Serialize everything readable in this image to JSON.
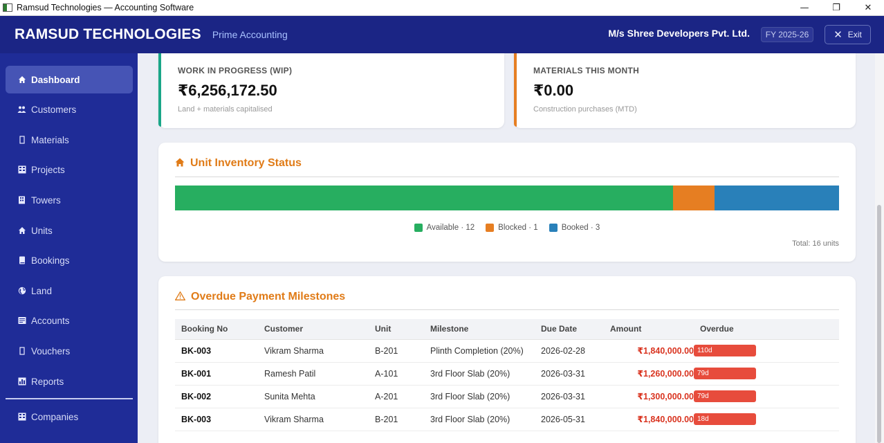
{
  "window": {
    "title": "Ramsud Technologies — Accounting Software"
  },
  "header": {
    "brand": "RAMSUD TECHNOLOGIES",
    "subtitle": "Prime Accounting",
    "company": "M/s Shree Developers Pvt. Ltd.",
    "fy": "FY 2025-26",
    "exit_label": "Exit"
  },
  "sidebar": {
    "items": [
      {
        "label": "Dashboard",
        "icon": "home-icon",
        "active": true
      },
      {
        "label": "Customers",
        "icon": "users-icon"
      },
      {
        "label": "Materials",
        "icon": "box-icon"
      },
      {
        "label": "Projects",
        "icon": "grid-icon"
      },
      {
        "label": "Towers",
        "icon": "building-icon"
      },
      {
        "label": "Units",
        "icon": "home-icon"
      },
      {
        "label": "Bookings",
        "icon": "book-icon"
      },
      {
        "label": "Land",
        "icon": "globe-icon"
      },
      {
        "label": "Accounts",
        "icon": "ledger-icon"
      },
      {
        "label": "Vouchers",
        "icon": "voucher-icon"
      },
      {
        "label": "Reports",
        "icon": "chart-icon"
      },
      {
        "label": "Companies",
        "icon": "grid-icon"
      }
    ]
  },
  "cards": {
    "wip": {
      "label": "WORK IN PROGRESS (WIP)",
      "value": "₹6,256,172.50",
      "sub": "Land + materials capitalised",
      "color": "#1aa688"
    },
    "materials": {
      "label": "MATERIALS THIS MONTH",
      "value": "₹0.00",
      "sub": "Construction purchases (MTD)",
      "color": "#e67e22"
    }
  },
  "inventory": {
    "title": "Unit Inventory Status",
    "total_label": "Total: 16 units",
    "segments": [
      {
        "label": "Available · 12",
        "count": 12,
        "color": "#27ae60"
      },
      {
        "label": "Blocked · 1",
        "count": 1,
        "color": "#e67e22"
      },
      {
        "label": "Booked · 3",
        "count": 3,
        "color": "#2980b9"
      }
    ]
  },
  "overdue": {
    "title": "Overdue Payment Milestones",
    "columns": [
      "Booking No",
      "Customer",
      "Unit",
      "Milestone",
      "Due Date",
      "Amount",
      "Overdue"
    ],
    "rows": [
      {
        "booking": "BK-003",
        "customer": "Vikram Sharma",
        "unit": "B-201",
        "milestone": "Plinth Completion (20%)",
        "due": "2026-02-28",
        "amount": "₹1,840,000.00",
        "overdue": "110d"
      },
      {
        "booking": "BK-001",
        "customer": "Ramesh Patil",
        "unit": "A-101",
        "milestone": "3rd Floor Slab (20%)",
        "due": "2026-03-31",
        "amount": "₹1,260,000.00",
        "overdue": "79d"
      },
      {
        "booking": "BK-002",
        "customer": "Sunita Mehta",
        "unit": "A-201",
        "milestone": "3rd Floor Slab (20%)",
        "due": "2026-03-31",
        "amount": "₹1,300,000.00",
        "overdue": "79d"
      },
      {
        "booking": "BK-003",
        "customer": "Vikram Sharma",
        "unit": "B-201",
        "milestone": "3rd Floor Slab (20%)",
        "due": "2026-05-31",
        "amount": "₹1,840,000.00",
        "overdue": "18d"
      }
    ]
  }
}
